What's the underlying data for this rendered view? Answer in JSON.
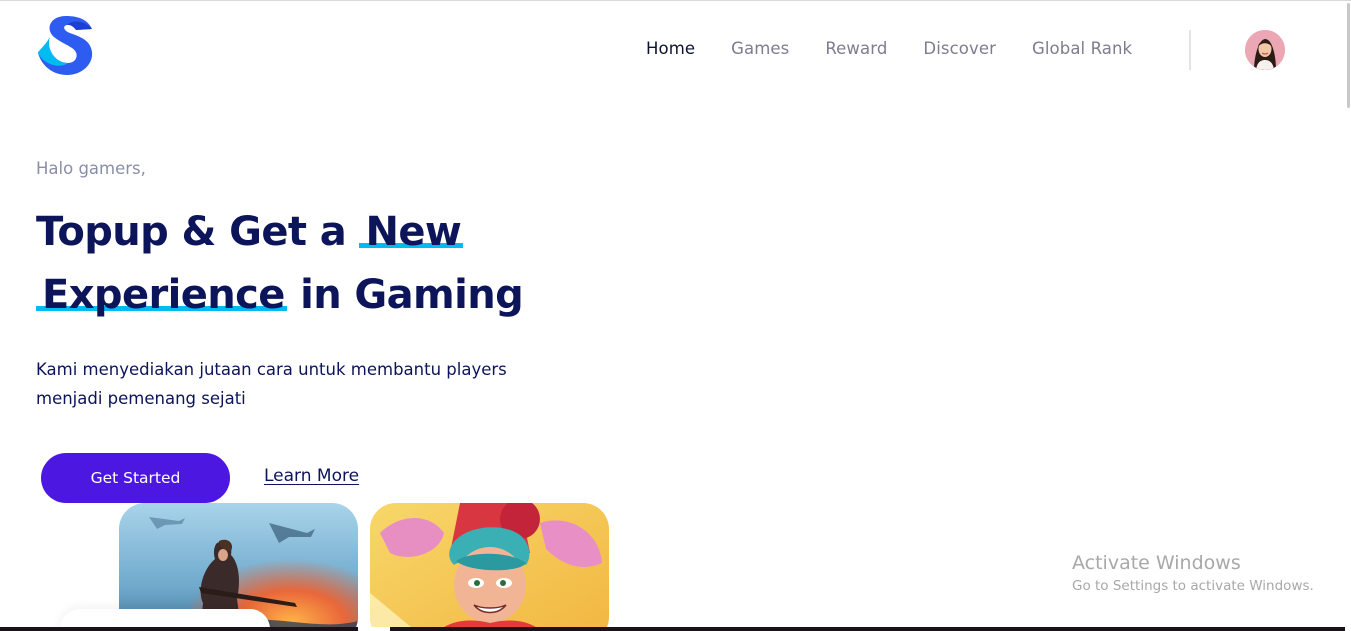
{
  "brand": {
    "logo_icon": "s-logo-icon",
    "colors": {
      "logo_dark": "#2e5cf0",
      "logo_light": "#00baf2"
    }
  },
  "nav": {
    "items": [
      {
        "label": "Home",
        "active": true
      },
      {
        "label": "Games",
        "active": false
      },
      {
        "label": "Reward",
        "active": false
      },
      {
        "label": "Discover",
        "active": false
      },
      {
        "label": "Global Rank",
        "active": false
      }
    ],
    "avatar_icon": "user-avatar"
  },
  "hero": {
    "greeting": "Halo gamers,",
    "headline": {
      "part1": "Topup & Get a",
      "highlight1": "New",
      "highlight2": "Experience",
      "part2": "in Gaming"
    },
    "description": "Kami menyediakan jutaan cara untuk membantu players menjadi pemenang sejati",
    "primary_button": "Get Started",
    "secondary_link": "Learn More"
  },
  "featured_games": [
    {
      "icon": "battlefield-cover-image"
    },
    {
      "icon": "arcade-hero-cover-image"
    }
  ],
  "os_watermark": {
    "title": "Activate Windows",
    "subtitle": "Go to Settings to activate Windows."
  },
  "theme": {
    "primary": "#4d17e2",
    "heading": "#0c145a",
    "accent_underline": "#00baf2",
    "muted_text": "#8a8ea6"
  }
}
